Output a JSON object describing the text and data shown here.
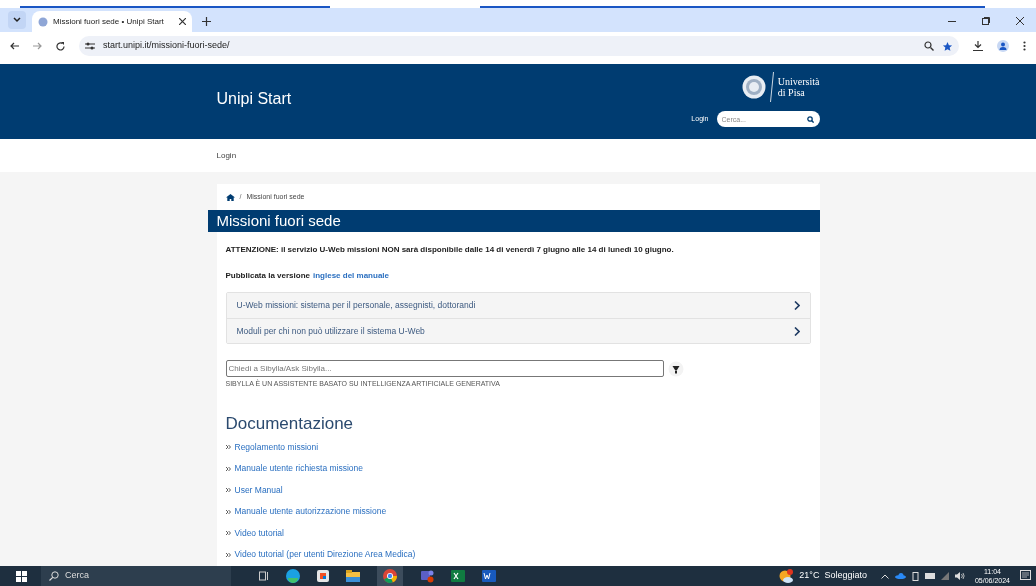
{
  "browser": {
    "tab_title": "Missioni fuori sede • Unipi Start",
    "url": "start.unipi.it/missioni-fuori-sede/"
  },
  "header": {
    "site_title": "Unipi Start",
    "logo_line_1": "Università",
    "logo_line_2": "di Pisa",
    "login": "Login",
    "search_placeholder": "Cerca..."
  },
  "nav": {
    "login": "Login"
  },
  "breadcrumb": {
    "separator": "/",
    "items": [
      "Missioni fuori sede"
    ]
  },
  "page_title": "Missioni fuori sede",
  "notice": "**ATTENZIONE: il servizio U-Web missioni NON sarà disponibile dalle 14 di venerdì 7 giugno alle 14 di lunedì 10 giugno.**",
  "published": {
    "text": "Pubblicata la versione",
    "link": "inglese del manuale"
  },
  "accordion": [
    {
      "label": "U-Web missioni: sistema per il personale, assegnisti, dottorandi",
      "expanded": false
    },
    {
      "label": "Moduli per chi non può utilizzare il sistema U-Web",
      "expanded": false
    }
  ],
  "assistant": {
    "placeholder": "Chiedi a Sibylla/Ask Sibylla...",
    "note": "SIBYLLA È UN ASSISTENTE BASATO SU INTELLIGENZA ARTIFICIALE GENERATIVA"
  },
  "documentation": {
    "heading": "Documentazione",
    "links": [
      "Regolamento missioni",
      "Manuale utente richiesta missione",
      "User Manual",
      "Manuale utente autorizzazione missione",
      "Video tutorial",
      "Video tutorial (per utenti Direzione Area Medica)"
    ]
  },
  "taskbar": {
    "search": "Cerca",
    "weather": "21°C  Soleggiato",
    "time": "11:04",
    "date": "05/06/2024"
  }
}
